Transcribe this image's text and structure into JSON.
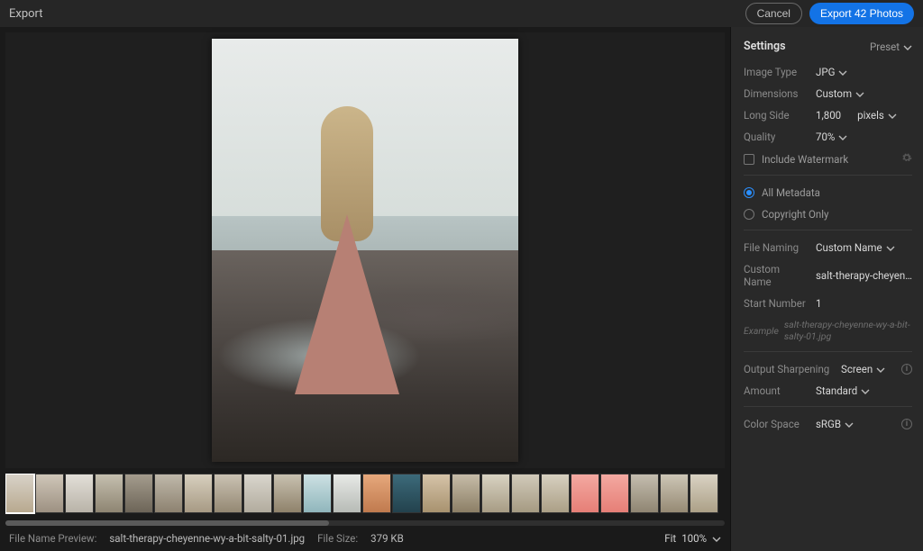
{
  "titlebar": {
    "title": "Export",
    "cancel_label": "Cancel",
    "export_label": "Export 42 Photos"
  },
  "footer": {
    "filename_preview_label": "File Name Preview:",
    "filename_preview_value": "salt-therapy-cheyenne-wy-a-bit-salty-01.jpg",
    "filesize_label": "File Size:",
    "filesize_value": "379 KB",
    "fit_label": "Fit",
    "fit_value": "100%"
  },
  "settings": {
    "header": "Settings",
    "preset_label": "Preset",
    "image_type": {
      "label": "Image Type",
      "value": "JPG"
    },
    "dimensions": {
      "label": "Dimensions",
      "value": "Custom"
    },
    "long_side": {
      "label": "Long Side",
      "value": "1,800",
      "unit": "pixels"
    },
    "quality": {
      "label": "Quality",
      "value": "70%"
    },
    "watermark": {
      "label": "Include Watermark"
    },
    "metadata_all": "All Metadata",
    "metadata_copyright": "Copyright Only",
    "file_naming": {
      "label": "File Naming",
      "value": "Custom Name"
    },
    "custom_name": {
      "label": "Custom Name",
      "value": "salt-therapy-cheyenne-wy-a-b"
    },
    "start_number": {
      "label": "Start Number",
      "value": "1"
    },
    "example_label": "Example",
    "example_value": "salt-therapy-cheyenne-wy-a-bit-salty-01.jpg",
    "output_sharpening": {
      "label": "Output Sharpening",
      "value": "Screen"
    },
    "amount": {
      "label": "Amount",
      "value": "Standard"
    },
    "color_space": {
      "label": "Color Space",
      "value": "sRGB"
    }
  }
}
